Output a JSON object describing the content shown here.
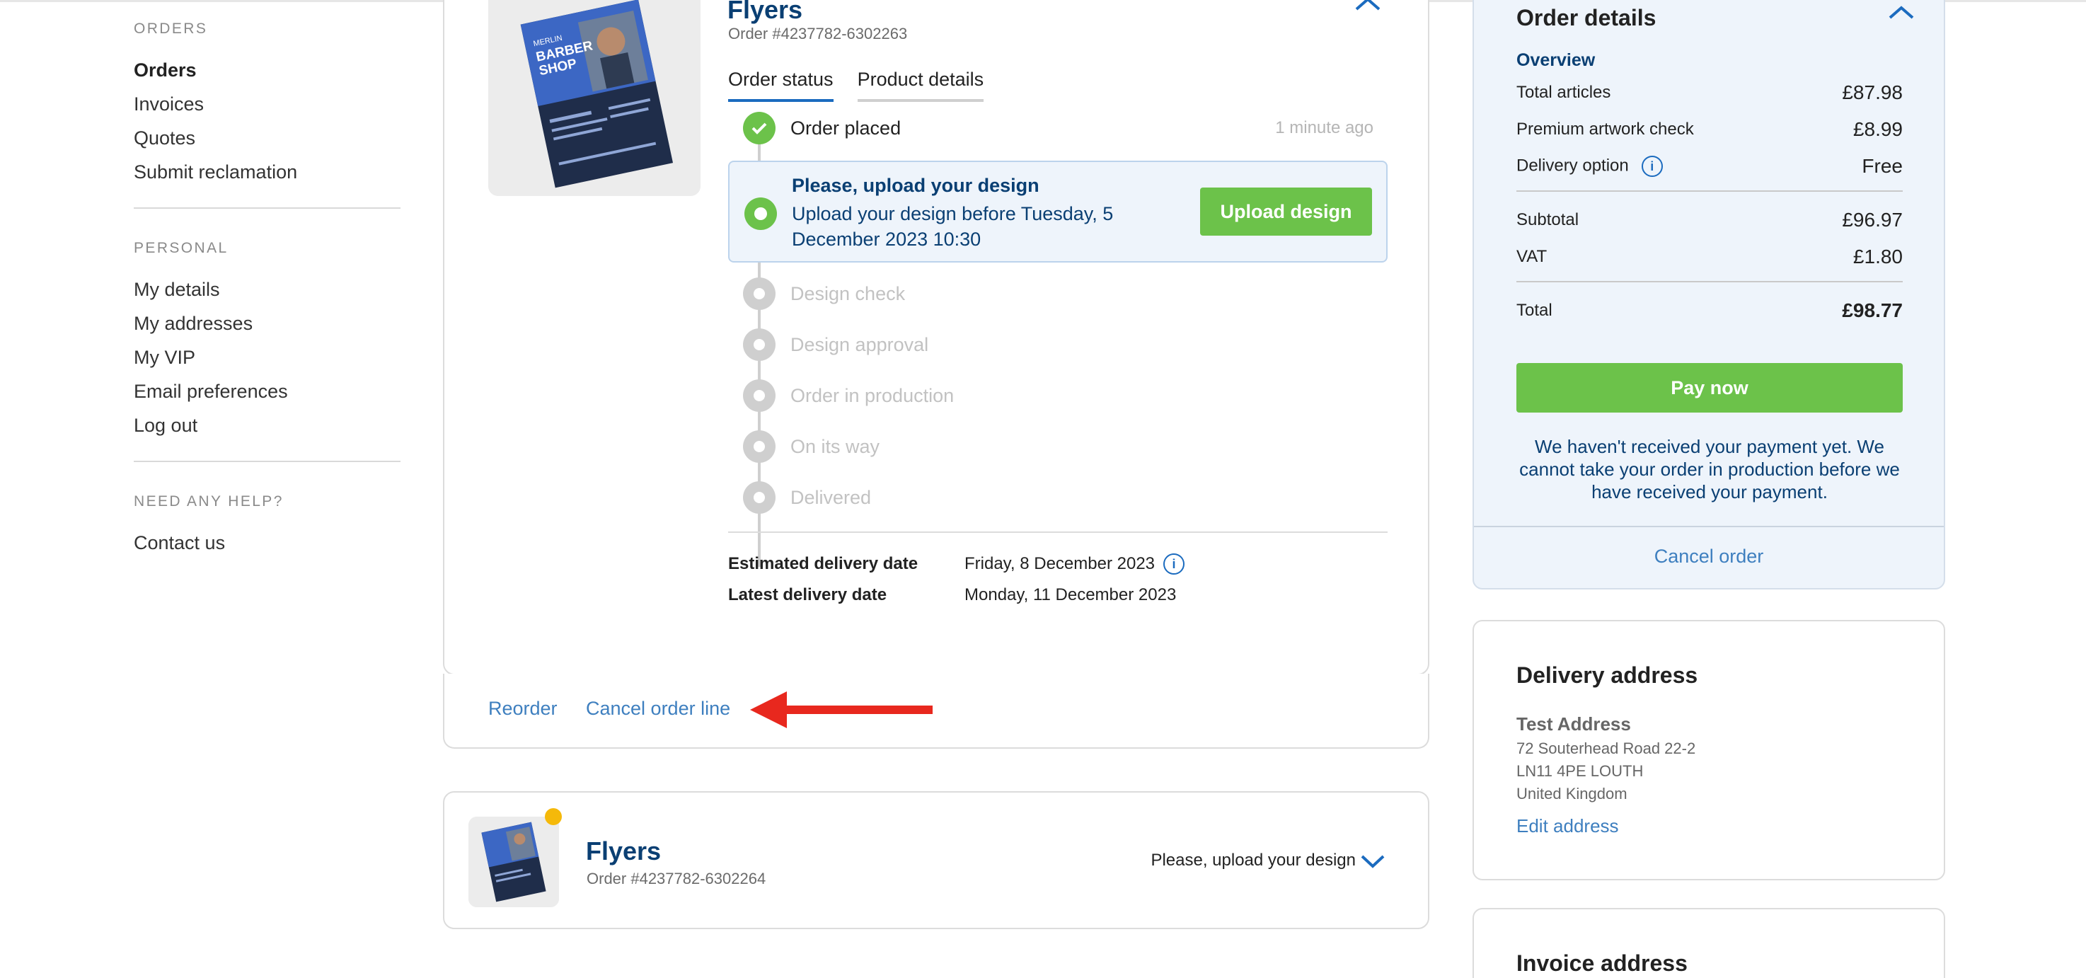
{
  "sidebar": {
    "orders_title": "ORDERS",
    "orders_items": [
      "Orders",
      "Invoices",
      "Quotes",
      "Submit reclamation"
    ],
    "personal_title": "PERSONAL",
    "personal_items": [
      "My details",
      "My addresses",
      "My VIP",
      "Email preferences",
      "Log out"
    ],
    "help_title": "NEED ANY HELP?",
    "help_items": [
      "Contact us"
    ]
  },
  "order_card": {
    "title": "Flyers",
    "order_no": "Order #4237782-6302263",
    "tabs": [
      "Order status",
      "Product details"
    ],
    "steps": {
      "placed": "Order placed",
      "placed_time": "1 minute ago",
      "current_title": "Please, upload your design",
      "current_text": "Upload your design before Tuesday, 5 December 2023 10:30",
      "upload_button": "Upload design",
      "pending": [
        "Design check",
        "Design approval",
        "Order in production",
        "On its way",
        "Delivered"
      ]
    },
    "dates": {
      "estimated_label": "Estimated delivery date",
      "estimated_value": "Friday, 8 December 2023",
      "latest_label": "Latest delivery date",
      "latest_value": "Monday, 11 December 2023"
    },
    "actions": {
      "reorder": "Reorder",
      "cancel_line": "Cancel order line"
    }
  },
  "thumbnail_text": {
    "line1": "MERLIN",
    "line2": "BARBER",
    "line3": "SHOP"
  },
  "second_order": {
    "title": "Flyers",
    "order_no": "Order #4237782-6302264",
    "status": "Please, upload your design"
  },
  "summary": {
    "title": "Order details",
    "overview": "Overview",
    "total_articles_label": "Total articles",
    "total_articles": "£87.98",
    "artwork_label": "Premium artwork check",
    "artwork": "£8.99",
    "delivery_label": "Delivery option",
    "delivery": "Free",
    "subtotal_label": "Subtotal",
    "subtotal": "£96.97",
    "vat_label": "VAT",
    "vat": "£1.80",
    "total_label": "Total",
    "total": "£98.77",
    "pay_button": "Pay now",
    "pay_note": "We haven't received your payment yet. We cannot take your order in production before we have received your payment.",
    "cancel_order": "Cancel order"
  },
  "delivery_address": {
    "title": "Delivery address",
    "name": "Test Address",
    "line1": "72 Souterhead Road 22-2",
    "line2": "LN11 4PE LOUTH",
    "line3": "United Kingdom",
    "edit": "Edit address"
  },
  "invoice_address": {
    "title": "Invoice address"
  },
  "colors": {
    "brand_green": "#6cc24a",
    "brand_navy": "#0a3f73",
    "link_blue": "#3e7fbf",
    "annotation_red": "#e8281e"
  }
}
